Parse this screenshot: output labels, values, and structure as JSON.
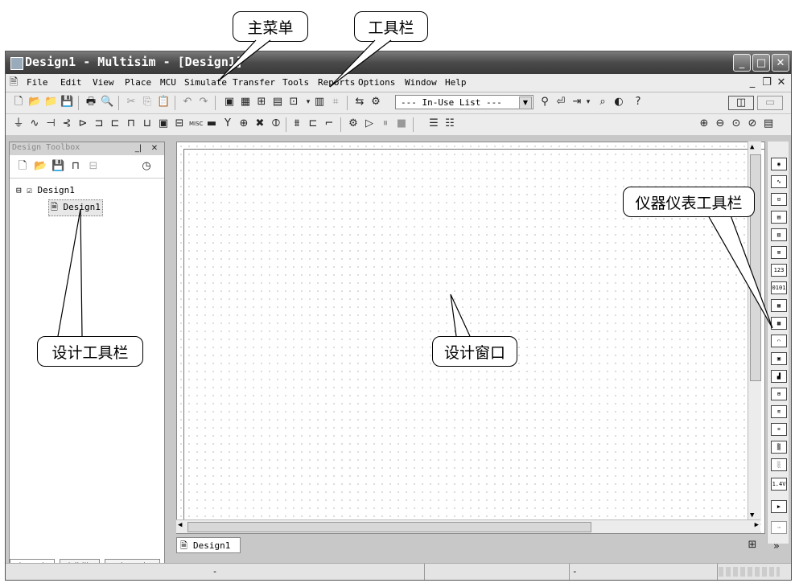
{
  "callouts": {
    "main_menu": "主菜单",
    "toolbar": "工具栏",
    "instrument_toolbar": "仪器仪表工具栏",
    "design_toolbox": "设计工具栏",
    "design_window": "设计窗口"
  },
  "window": {
    "title": "Design1 - Multisim - [Design1]"
  },
  "menu": [
    "File",
    "Edit",
    "View",
    "Place",
    "MCU",
    "Simulate",
    "Transfer",
    "Tools",
    "Reports",
    "Options",
    "Window",
    "Help"
  ],
  "toolbar": {
    "in_use_list": "--- In-Use List ---"
  },
  "toolbox": {
    "title": "Design Toolbox",
    "tree_root": "Design1",
    "tree_child": "Design1",
    "tabs": [
      "Hierarchy",
      "Visibility",
      "Project View"
    ]
  },
  "document_tab": "Design1",
  "status": {
    "cell1": "-",
    "cell2": "-"
  }
}
